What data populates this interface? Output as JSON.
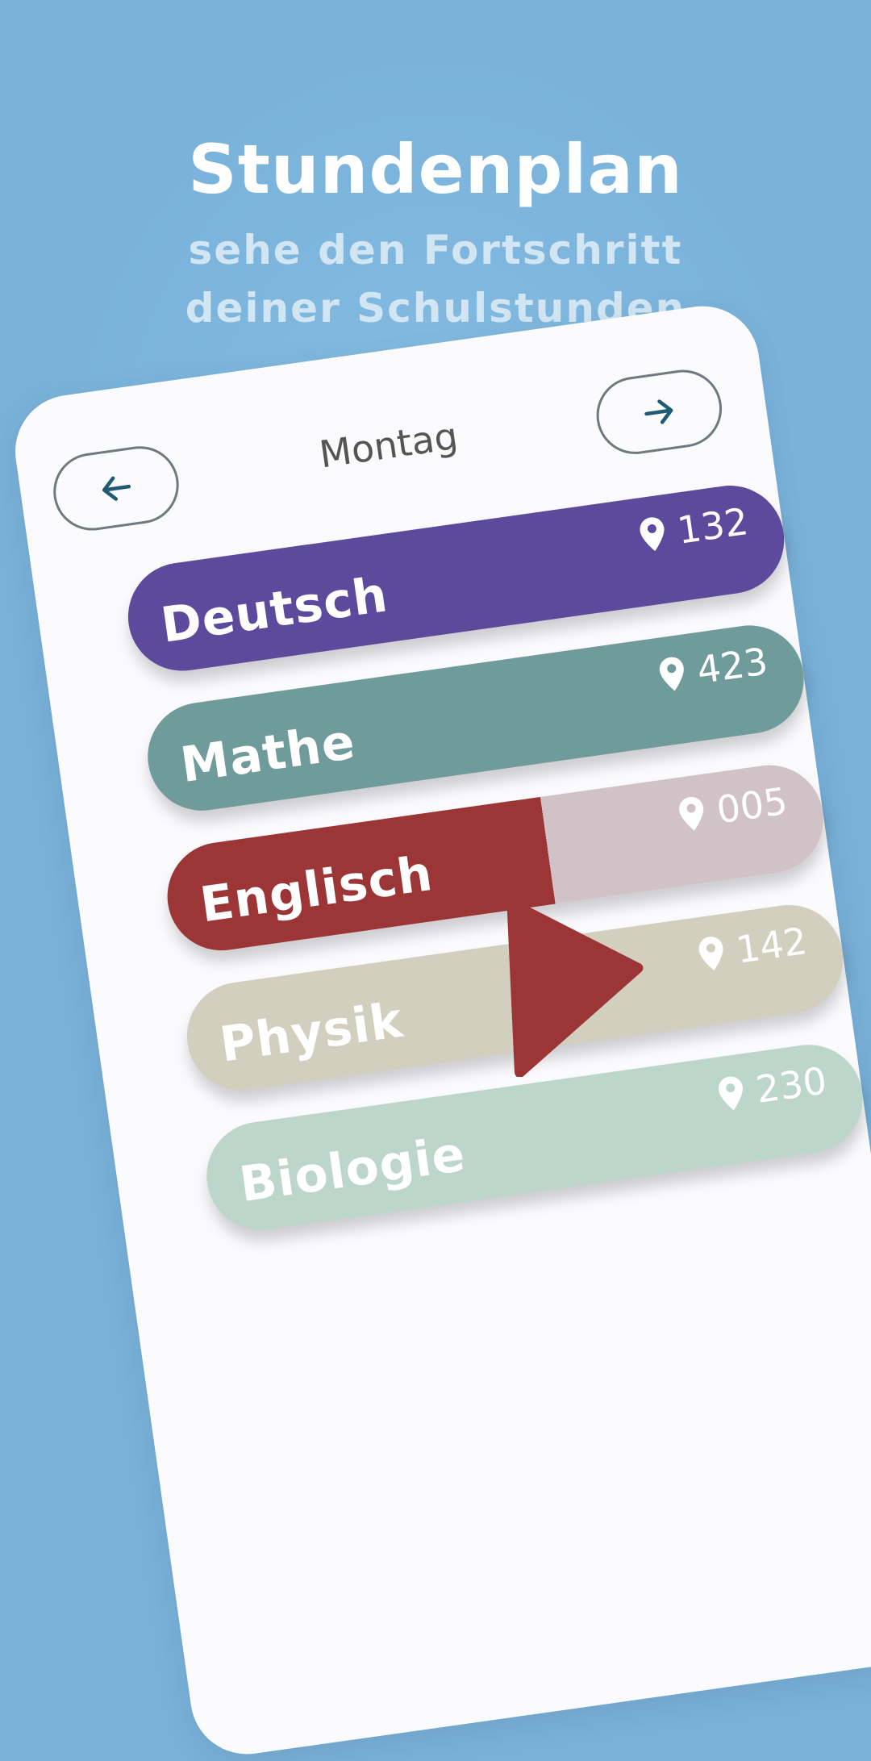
{
  "header": {
    "title": "Stundenplan",
    "subtitle": "sehe den Fortschritt deiner Schulstunden"
  },
  "schedule": {
    "day": "Montag",
    "prev_icon": "arrow-left-icon",
    "next_icon": "arrow-right-icon",
    "lessons": [
      {
        "name": "Deutsch",
        "room": "132",
        "color": "#5c4a9c"
      },
      {
        "name": "Mathe",
        "room": "423",
        "color": "#6f9b9b"
      },
      {
        "name": "Englisch",
        "room": "005",
        "color": "#9c3636"
      },
      {
        "name": "Physik",
        "room": "142",
        "color": "#d2cfbe"
      },
      {
        "name": "Biologie",
        "room": "230",
        "color": "#bcd6cb"
      }
    ]
  },
  "highlight": {
    "icon": "arrow-right-icon",
    "color": "#9c3636",
    "faded_row_color": "#d0c2c6"
  }
}
